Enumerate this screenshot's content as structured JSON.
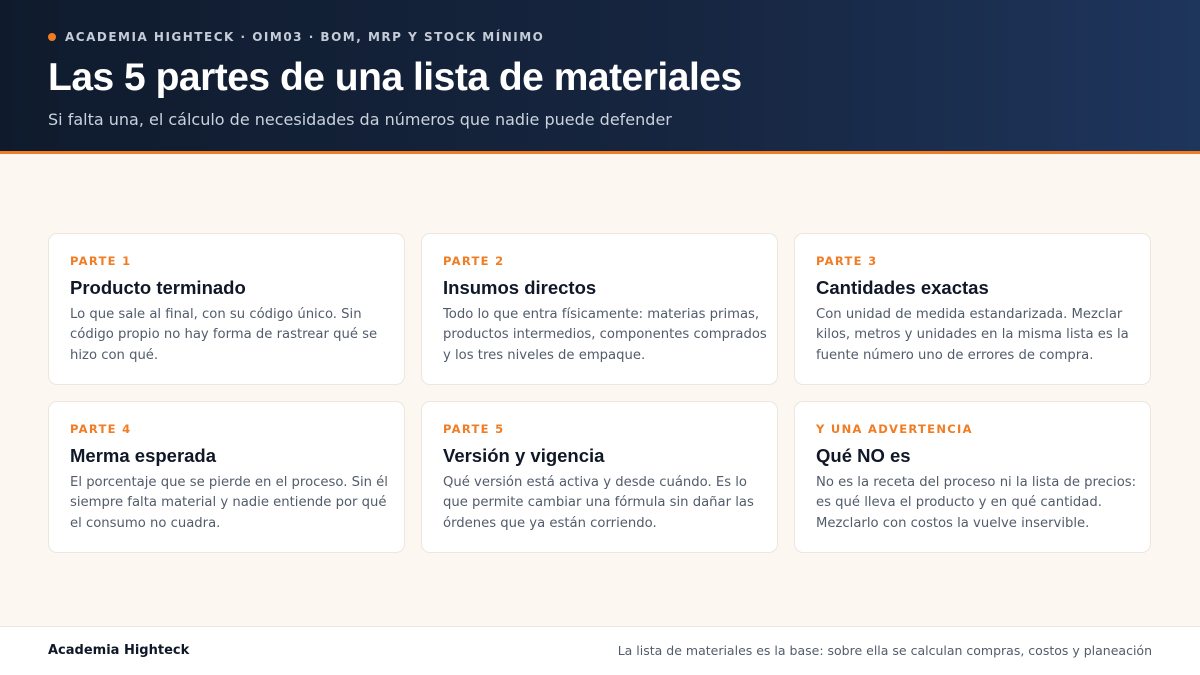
{
  "header": {
    "kicker": "ACADEMIA HIGHTECK · OIM03 · BOM, MRP Y STOCK MÍNIMO",
    "title": "Las 5 partes de una lista de materiales",
    "subtitle": "Si falta una, el cálculo de necesidades da números que nadie puede defender",
    "accent_color": "#f07c23"
  },
  "cards": [
    {
      "kicker": "PARTE 1",
      "title": "Producto terminado",
      "body": [
        "Lo que sale al final, con su código único. Sin",
        "código propio no hay forma de rastrear qué se",
        "hizo con qué."
      ]
    },
    {
      "kicker": "PARTE 2",
      "title": "Insumos directos",
      "body": [
        "Todo lo que entra físicamente: materias primas,",
        "productos intermedios, componentes comprados",
        "y los tres niveles de empaque."
      ]
    },
    {
      "kicker": "PARTE 3",
      "title": "Cantidades exactas",
      "body": [
        "Con unidad de medida estandarizada. Mezclar",
        "kilos, metros y unidades en la misma lista es la",
        "fuente número uno de errores de compra."
      ]
    },
    {
      "kicker": "PARTE 4",
      "title": "Merma esperada",
      "body": [
        "El porcentaje que se pierde en el proceso. Sin él",
        "siempre falta material y nadie entiende por qué",
        "el consumo no cuadra."
      ]
    },
    {
      "kicker": "PARTE 5",
      "title": "Versión y vigencia",
      "body": [
        "Qué versión está activa y desde cuándo. Es lo",
        "que permite cambiar una fórmula sin dañar las",
        "órdenes que ya están corriendo."
      ]
    },
    {
      "kicker": "Y UNA ADVERTENCIA",
      "title": "Qué NO es",
      "body": [
        "No es la receta del proceso ni la lista de precios:",
        "es qué lleva el producto y en qué cantidad.",
        "Mezclarlo con costos la vuelve inservible."
      ]
    }
  ],
  "footer": {
    "brand": "Academia Highteck",
    "note": "La lista de materiales es la base: sobre ella se calculan compras, costos y planeación"
  }
}
